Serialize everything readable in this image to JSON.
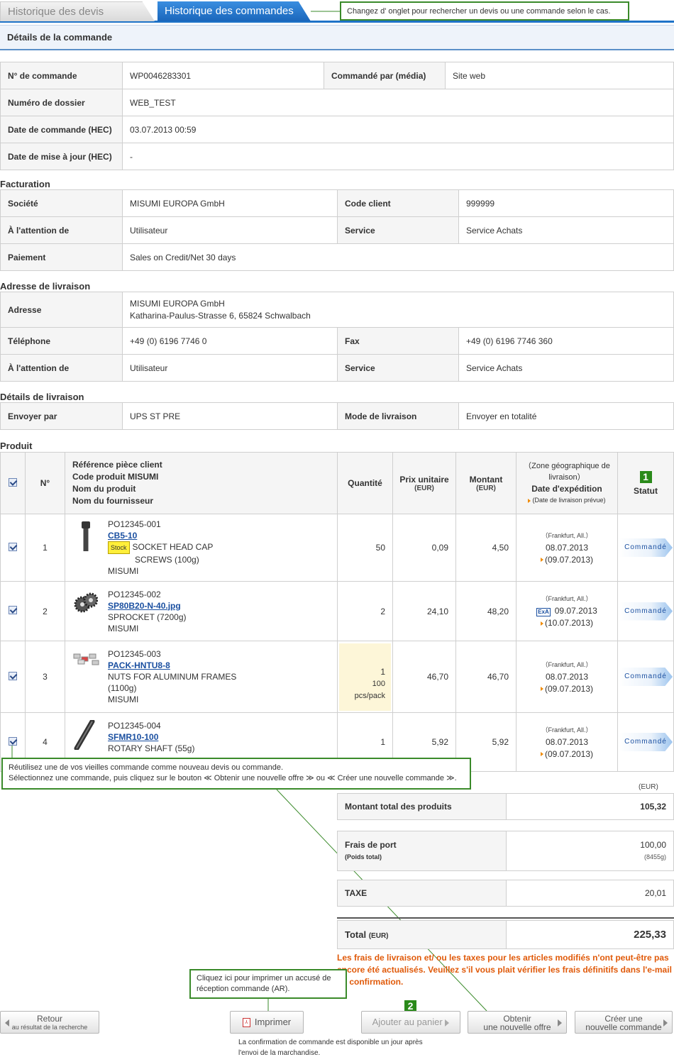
{
  "tabs": [
    {
      "label": "Historique des devis"
    },
    {
      "label": "Historique des commandes"
    }
  ],
  "callouts": {
    "tabs": "Changez d' onglet pour rechercher un devis ou une commande selon le cas.",
    "reuse_1": "Réutilisez une de vos vieilles commande comme nouveau devis ou commande.",
    "reuse_2": "Sélectionnez une commande, puis cliquez sur le bouton ≪ Obtenir une nouvelle offre ≫ ou ≪ Créer une nouvelle commande ≫.",
    "print": "Cliquez ici pour imprimer un accusé de réception commande (AR)."
  },
  "header": {
    "title": "Détails de la commande"
  },
  "order": {
    "order_no_label": "N° de commande",
    "order_no": "WP0046283301",
    "ordered_by_label": "Commandé par (média)",
    "ordered_by": "Site web",
    "file_no_label": "Numéro de dossier",
    "file_no": "WEB_TEST",
    "order_date_label": "Date de commande (HEC)",
    "order_date": "03.07.2013 00:59",
    "update_date_label": "Date de mise à jour (HEC)",
    "update_date": "-"
  },
  "billing": {
    "title": "Facturation",
    "company_label": "Société",
    "company": "MISUMI EUROPA GmbH",
    "client_code_label": "Code client",
    "client_code": "999999",
    "attention_label": "À l'attention de",
    "attention": "Utilisateur",
    "service_label": "Service",
    "service": "Service Achats",
    "payment_label": "Paiement",
    "payment": "Sales on Credit/Net 30 days"
  },
  "delivery_address": {
    "title": "Adresse de livraison",
    "address_label": "Adresse",
    "address_1": "MISUMI EUROPA GmbH",
    "address_2": "Katharina-Paulus-Strasse 6, 65824 Schwalbach",
    "phone_label": "Téléphone",
    "phone": "+49 (0) 6196 7746 0",
    "fax_label": "Fax",
    "fax": "+49 (0) 6196 7746 360",
    "attention_label": "À l'attention de",
    "attention": "Utilisateur",
    "service_label": "Service",
    "service": "Service Achats"
  },
  "delivery_details": {
    "title": "Détails de livraison",
    "send_by_label": "Envoyer par",
    "send_by": "UPS ST PRE",
    "mode_label": "Mode de livraison",
    "mode": "Envoyer en totalité"
  },
  "products": {
    "title": "Produit",
    "headers": {
      "no": "N°",
      "ref_1": "Référence pièce client",
      "ref_2": "Code produit MISUMI",
      "ref_3": "Nom du produit",
      "ref_4": "Nom du fournisseur",
      "qty": "Quantité",
      "unit_price": "Prix unitaire",
      "unit_price_cur": "(EUR)",
      "amount": "Montant",
      "amount_cur": "(EUR)",
      "zone_1": "（Zone géographique de",
      "zone_2": "livraison）",
      "ship_date": "Date d'expédition",
      "planned": "(Date de livraison prévue)",
      "status_badge": "1",
      "status": "Statut"
    },
    "rows": [
      {
        "no": "1",
        "ref": "PO12345-001",
        "code": "CB5-10",
        "stock": "Stock",
        "name_1": "SOCKET HEAD CAP",
        "name_2": "SCREWS (100g)",
        "supplier": "MISUMI",
        "qty": "50",
        "unit": "0,09",
        "amount": "4,50",
        "zone": "（Frankfurt, All.）",
        "ship": "08.07.2013",
        "deliv": "(09.07.2013)",
        "status": "Commandé"
      },
      {
        "no": "2",
        "ref": "PO12345-002",
        "code": "SP80B20-N-40.jpg",
        "name_1": "SPROCKET (7200g)",
        "supplier": "MISUMI",
        "qty": "2",
        "unit": "24,10",
        "amount": "48,20",
        "zone": "（Frankfurt, All.）",
        "express": "ExA",
        "ship": "09.07.2013",
        "deliv": "(10.07.2013)",
        "status": "Commandé"
      },
      {
        "no": "3",
        "ref": "PO12345-003",
        "code": "PACK-HNTU8-8",
        "name_1": "NUTS FOR ALUMINUM FRAMES",
        "name_2": "(1100g)",
        "supplier": "MISUMI",
        "qty": "1",
        "pack_1": "100",
        "pack_2": "pcs/pack",
        "unit": "46,70",
        "amount": "46,70",
        "zone": "（Frankfurt, All.）",
        "ship": "08.07.2013",
        "deliv": "(09.07.2013)",
        "status": "Commandé"
      },
      {
        "no": "4",
        "ref": "PO12345-004",
        "code": "SFMR10-100",
        "name_1": "ROTARY SHAFT (55g)",
        "qty": "1",
        "unit": "5,92",
        "amount": "5,92",
        "zone": "（Frankfurt, All.）",
        "ship": "08.07.2013",
        "deliv": "(09.07.2013)",
        "status": "Commandé"
      }
    ]
  },
  "totals": {
    "currency": "(EUR)",
    "products_label": "Montant total des produits",
    "products": "105,32",
    "shipping_label": "Frais de port",
    "weight_label": "(Poids total)",
    "shipping": "100,00",
    "weight": "(8455g)",
    "tax_label": "TAXE",
    "tax": "20,01",
    "total_label": "Total",
    "total_cur": "(EUR)",
    "total": "225,33",
    "warning": "Les frais de livraison et/ ou les taxes pour les articles modifiés n'ont peut-être pas encore été actualisés. Veuillez s'il vous plait vérifier les frais définitifs dans l'e-mail de confirmation."
  },
  "buttons": {
    "back_1": "Retour",
    "back_2": "au résultat de la recherche",
    "print": "Imprimer",
    "cart": "Ajouter au panier",
    "cart_badge": "2",
    "quote_1": "Obtenir",
    "quote_2": "une nouvelle offre",
    "order_1": "Créer une",
    "order_2": "nouvelle commande",
    "print_note_1": "La confirmation de commande est disponible un jour après",
    "print_note_2": "l'envoi de la marchandise."
  },
  "colors": {
    "accent": "#1e73c8",
    "callout_border": "#3a8a2a",
    "warning": "#e05a0a",
    "link": "#1a4fa0"
  }
}
